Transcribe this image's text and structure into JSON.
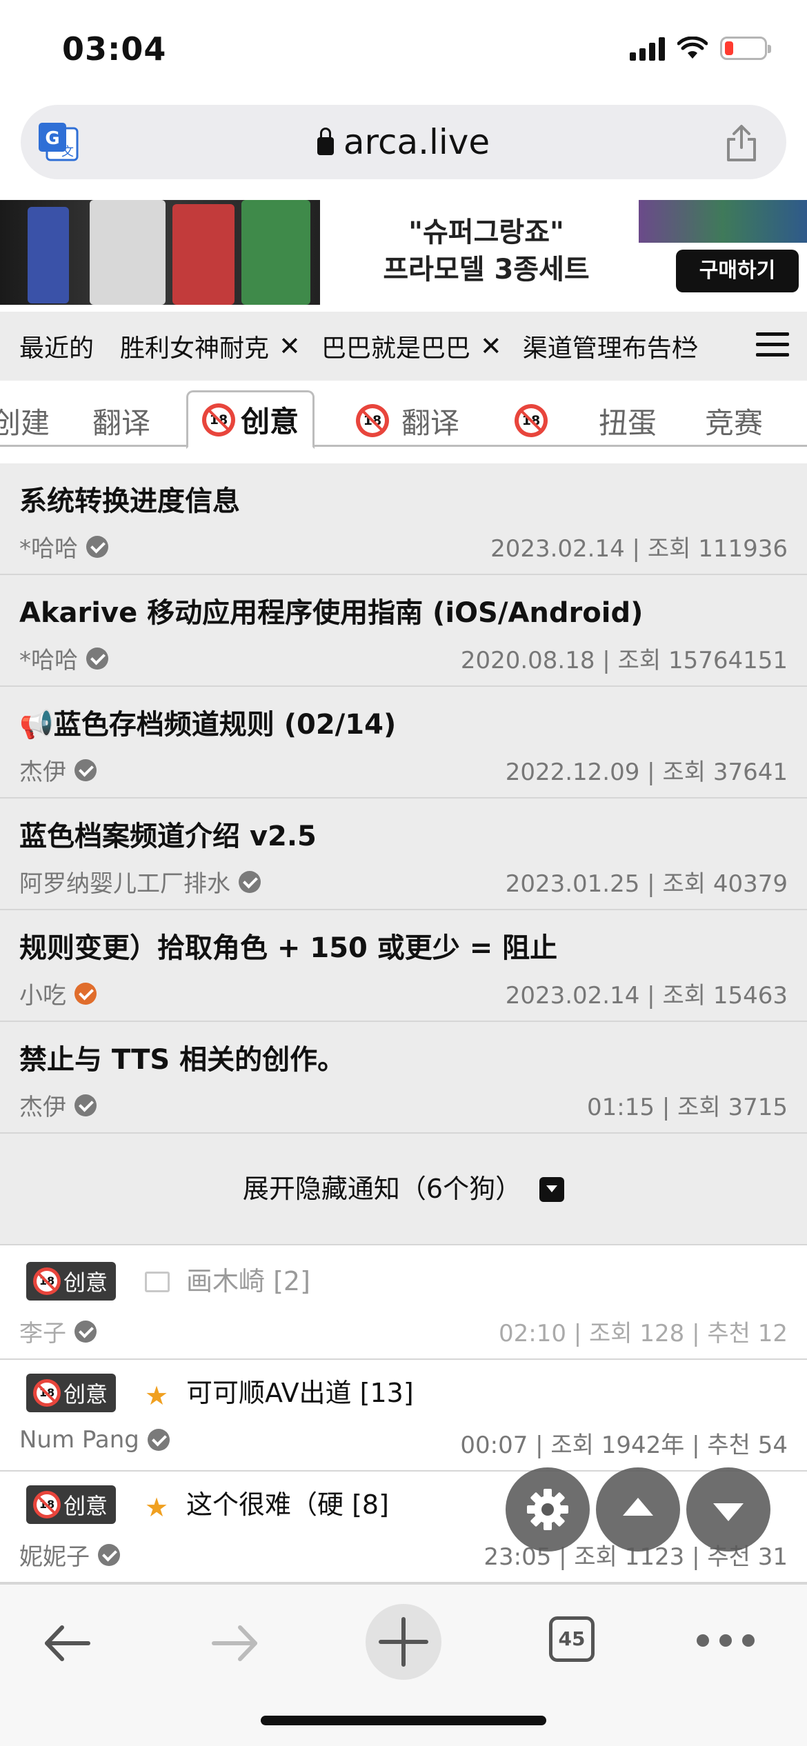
{
  "status": {
    "time": "03:04"
  },
  "browser": {
    "url": "arca.live",
    "tab_count": "45"
  },
  "banner": {
    "line1": "\"슈퍼그랑죠\"",
    "line2": "프라모델 3종세트",
    "buy_label": "구매하기"
  },
  "recent": {
    "label": "最近的",
    "chips": [
      "胜利女神耐克",
      "巴巴就是巴巴",
      "渠道管理布告栏"
    ]
  },
  "tabs": [
    {
      "label": "创建"
    },
    {
      "label": "翻译"
    },
    {
      "label": "创意"
    },
    {
      "label": "翻译"
    },
    {
      "label": ""
    },
    {
      "label": "扭蛋"
    },
    {
      "label": "竞赛"
    }
  ],
  "age_mark": "18",
  "notices": [
    {
      "title": "系统转换进度信息",
      "author": "*哈哈",
      "verified": "gray",
      "date": "2023.02.14",
      "views_label": "조회",
      "views": "111936"
    },
    {
      "title": "Akarive 移动应用程序使用指南 (iOS/Android)",
      "author": "*哈哈",
      "verified": "gray",
      "date": "2020.08.18",
      "views_label": "조회",
      "views": "15764151"
    },
    {
      "title": "📢蓝色存档频道规则 (02/14)",
      "author": "杰伊",
      "verified": "gray",
      "date": "2022.12.09",
      "views_label": "조회",
      "views": "37641"
    },
    {
      "title": "蓝色档案频道介绍 v2.5",
      "author": "阿罗纳婴儿工厂排水",
      "verified": "gray",
      "date": "2023.01.25",
      "views_label": "조회",
      "views": "40379"
    },
    {
      "title": "规则变更）拾取角色 + 150 或更少 = 阻止",
      "author": "小吃",
      "verified": "orange",
      "date": "2023.02.14",
      "views_label": "조회",
      "views": "15463"
    },
    {
      "title": "禁止与 TTS 相关的创作。",
      "author": "杰伊",
      "verified": "gray",
      "date": "01:15",
      "views_label": "조회",
      "views": "3715"
    }
  ],
  "expand_label": "展开隐藏通知（6个狗）",
  "posts": [
    {
      "badge": "创意",
      "icon": "folder-icon",
      "title": "画木崎 [2]",
      "author": "李子",
      "meta": "02:10  |  조회  128  |  추천  12",
      "dim": true
    },
    {
      "badge": "创意",
      "icon": "star-icon",
      "title": "可可顺AV出道 [13]",
      "author": "Num Pang",
      "meta": "00:07  |  조회  1942年  |  추천  54",
      "dim": false
    },
    {
      "badge": "创意",
      "icon": "star-icon",
      "title": "这个很难（硬 [8]",
      "author": "妮妮子",
      "meta": "23:05  |  조회  1123  |  추천  31",
      "dim": false
    }
  ],
  "colors": {
    "notice_bg": "#ececec",
    "badge_bg": "#3a3a3a",
    "age_red": "#e8453c",
    "star": "#f0a020",
    "verified_orange": "#e06d2c"
  }
}
